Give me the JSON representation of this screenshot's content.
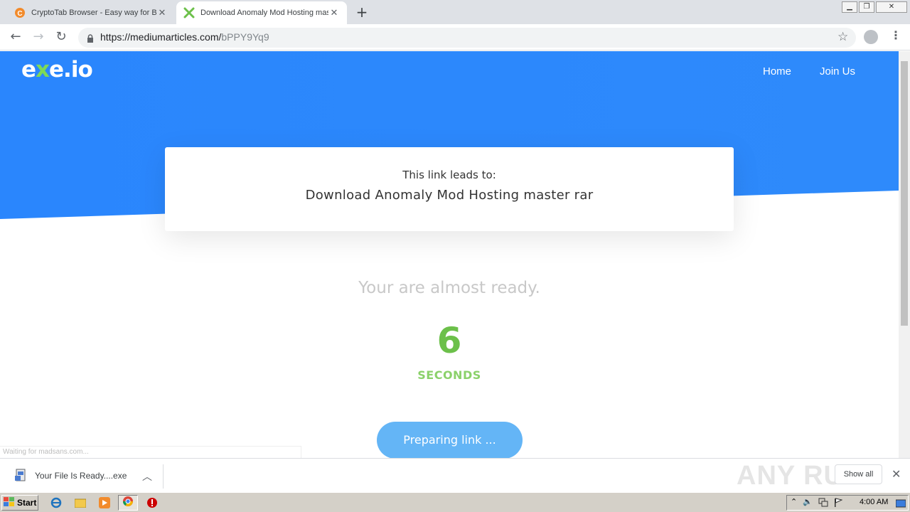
{
  "browser": {
    "tabs": [
      {
        "title": "CryptoTab Browser - Easy way for B",
        "active": false
      },
      {
        "title": "Download Anomaly Mod Hosting mas",
        "active": true
      }
    ],
    "url_host": "https://mediumarticles.com/",
    "url_path": "bPPY9Yq9"
  },
  "site": {
    "logo_prefix": "e",
    "logo_x": "x",
    "logo_suffix": "e.io",
    "nav": [
      "Home",
      "Join Us"
    ],
    "card_label": "This link leads to:",
    "card_title": "Download Anomaly Mod Hosting master rar",
    "almost_ready": "Your are almost ready.",
    "countdown": "6",
    "countdown_unit": "SECONDS",
    "button_label": "Preparing link ...",
    "status_text": "Waiting for madsans.com..."
  },
  "downloads": {
    "file_name": "Your File Is Ready....exe",
    "show_all": "Show all",
    "watermark": "ANY RUN"
  },
  "taskbar": {
    "start_label": "Start",
    "clock": "4:00 AM"
  },
  "colors": {
    "hero_blue": "#2a86fd",
    "accent_green": "#6cc04a",
    "button_blue": "#64b5f6"
  }
}
